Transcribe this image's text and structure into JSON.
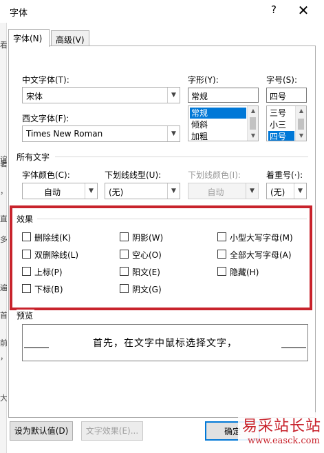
{
  "window": {
    "title": "字体",
    "help_glyph": "?",
    "close_glyph": "✕"
  },
  "left_strip": {
    "chars": [
      "看",
      "谊",
      "暑",
      "，",
      "直",
      "多",
      "遍",
      "首",
      "前",
      "，",
      "大"
    ]
  },
  "tabs": [
    {
      "label": "字体(N)",
      "active": true
    },
    {
      "label": "高级(V)",
      "active": false
    }
  ],
  "font_section": {
    "chinese_font_label": "中文字体(T):",
    "chinese_font_value": "宋体",
    "western_font_label": "西文字体(F):",
    "western_font_value": "Times New Roman",
    "style_label": "字形(Y):",
    "style_value": "常规",
    "style_options": [
      "常规",
      "倾斜",
      "加粗"
    ],
    "style_selected": 0,
    "size_label": "字号(S):",
    "size_value": "四号",
    "size_options": [
      "三号",
      "小三",
      "四号"
    ],
    "size_selected": 2
  },
  "all_text": {
    "heading": "所有文字",
    "font_color_label": "字体颜色(C):",
    "font_color_value": "自动",
    "underline_label": "下划线线型(U):",
    "underline_value": "(无)",
    "underline_color_label": "下划线颜色(I):",
    "underline_color_value": "自动",
    "emphasis_label": "着重号(·):",
    "emphasis_value": "(无)"
  },
  "effects": {
    "heading": "效果",
    "items": [
      {
        "label": "删除线(K)",
        "checked": false
      },
      {
        "label": "阴影(W)",
        "checked": false
      },
      {
        "label": "小型大写字母(M)",
        "checked": false
      },
      {
        "label": "双删除线(L)",
        "checked": false
      },
      {
        "label": "空心(O)",
        "checked": false
      },
      {
        "label": "全部大写字母(A)",
        "checked": false
      },
      {
        "label": "上标(P)",
        "checked": false
      },
      {
        "label": "阳文(E)",
        "checked": false
      },
      {
        "label": "隐藏(H)",
        "checked": false
      },
      {
        "label": "下标(B)",
        "checked": false
      },
      {
        "label": "阴文(G)",
        "checked": false
      }
    ],
    "highlight_color": "#c8232c"
  },
  "preview": {
    "heading": "预览",
    "text": "首先，在文字中鼠标选择文字，"
  },
  "buttons": {
    "set_default": "设为默认值(D)",
    "text_effects": "文字效果(E)...",
    "ok": "确定"
  },
  "watermark": {
    "brand": "易采站长站",
    "url": "www.easck.com"
  }
}
